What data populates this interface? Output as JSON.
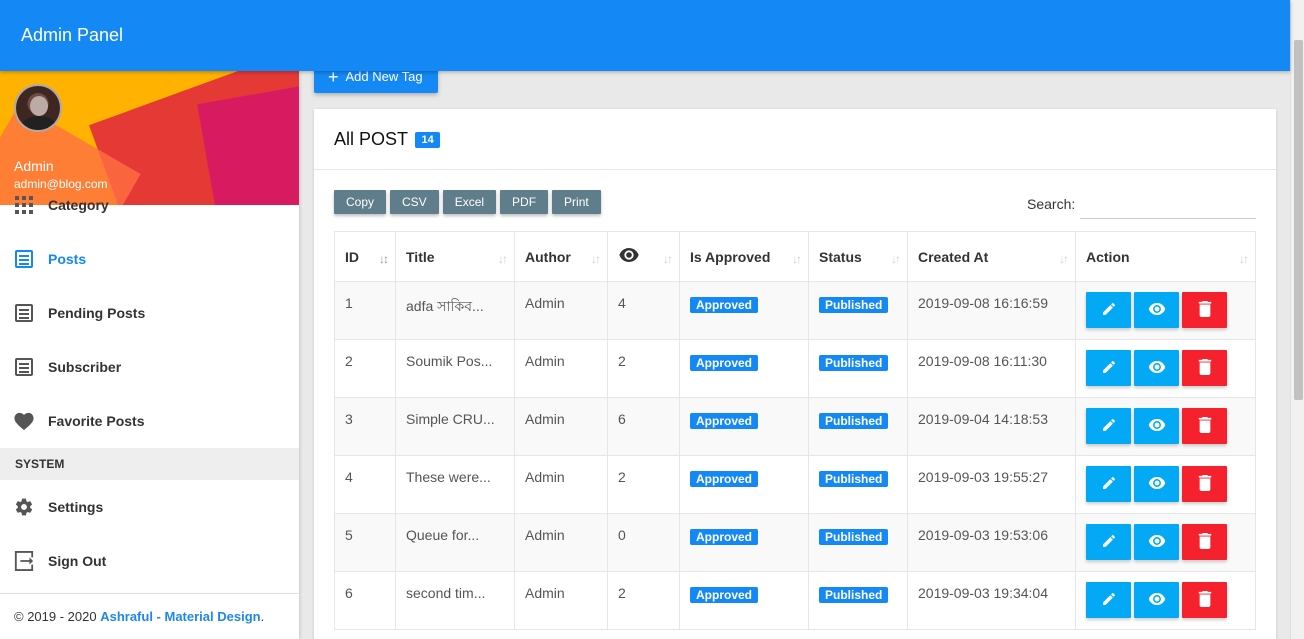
{
  "app": {
    "title": "Admin Panel"
  },
  "user": {
    "name": "Admin",
    "email": "admin@blog.com"
  },
  "sidebar": {
    "items": [
      {
        "label": "Category",
        "icon": "grid-icon"
      },
      {
        "label": "Posts",
        "icon": "list-icon",
        "active": true
      },
      {
        "label": "Pending Posts",
        "icon": "list-icon"
      },
      {
        "label": "Subscriber",
        "icon": "list-icon"
      },
      {
        "label": "Favorite Posts",
        "icon": "heart-icon"
      }
    ],
    "system_header": "SYSTEM",
    "system_items": [
      {
        "label": "Settings",
        "icon": "gear-icon"
      },
      {
        "label": "Sign Out",
        "icon": "sign-out-icon"
      }
    ],
    "footer": {
      "prefix": "© 2019 - 2020 ",
      "link": "Ashraful - Material Design",
      "suffix": "."
    }
  },
  "add_button": {
    "label": "Add New Tag"
  },
  "card": {
    "title": "All POST",
    "count": "14"
  },
  "export_buttons": [
    "Copy",
    "CSV",
    "Excel",
    "PDF",
    "Print"
  ],
  "search": {
    "label": "Search:",
    "value": "",
    "placeholder": ""
  },
  "table": {
    "headers": [
      "ID",
      "Title",
      "Author",
      "",
      "Is Approved",
      "Status",
      "Created At",
      "Action"
    ],
    "rows": [
      {
        "id": "1",
        "title": "adfa সাকিব...",
        "author": "Admin",
        "views": "4",
        "approved": "Approved",
        "status": "Published",
        "created": "2019-09-08 16:16:59"
      },
      {
        "id": "2",
        "title": "Soumik Pos...",
        "author": "Admin",
        "views": "2",
        "approved": "Approved",
        "status": "Published",
        "created": "2019-09-08 16:11:30"
      },
      {
        "id": "3",
        "title": "Simple CRU...",
        "author": "Admin",
        "views": "6",
        "approved": "Approved",
        "status": "Published",
        "created": "2019-09-04 14:18:53"
      },
      {
        "id": "4",
        "title": "These were...",
        "author": "Admin",
        "views": "2",
        "approved": "Approved",
        "status": "Published",
        "created": "2019-09-03 19:55:27"
      },
      {
        "id": "5",
        "title": "Queue for...",
        "author": "Admin",
        "views": "0",
        "approved": "Approved",
        "status": "Published",
        "created": "2019-09-03 19:53:06"
      },
      {
        "id": "6",
        "title": "second tim...",
        "author": "Admin",
        "views": "2",
        "approved": "Approved",
        "status": "Published",
        "created": "2019-09-03 19:34:04"
      }
    ]
  },
  "colors": {
    "primary": "#1488f5",
    "info": "#03a9f4",
    "danger": "#f5222d",
    "export": "#607d8b"
  }
}
